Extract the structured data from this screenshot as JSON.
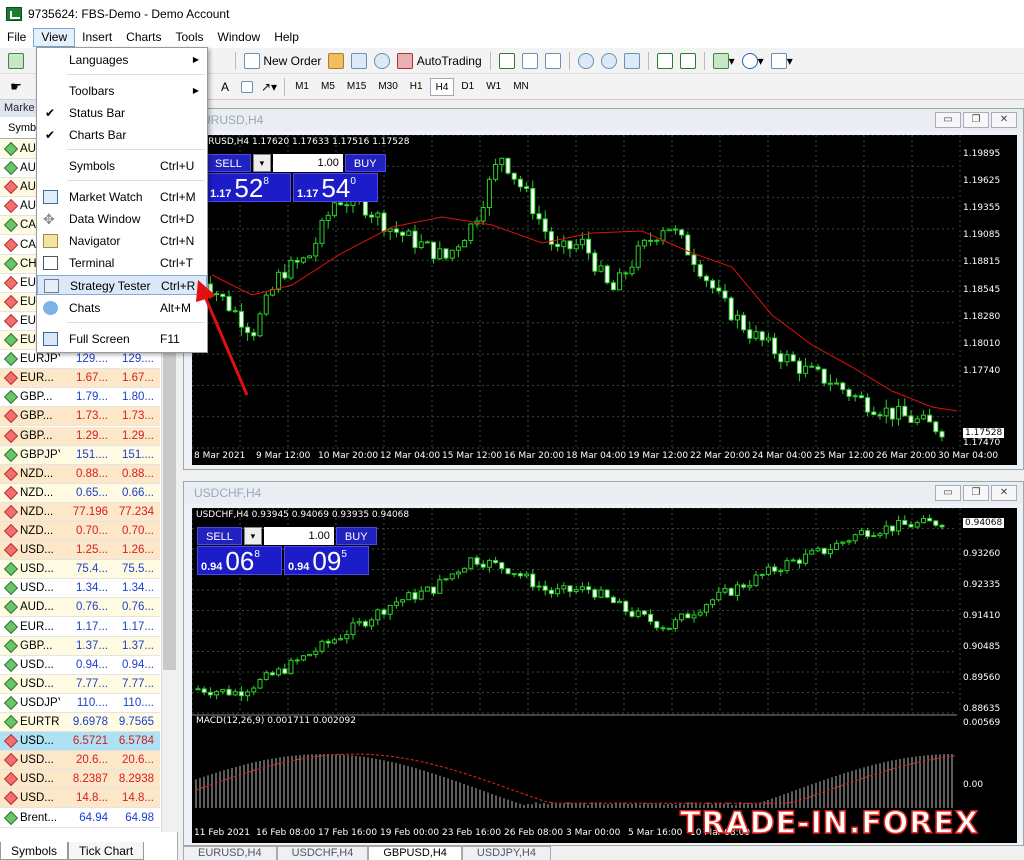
{
  "window": {
    "title": "9735624: FBS-Demo - Demo Account"
  },
  "menu": [
    "File",
    "View",
    "Insert",
    "Charts",
    "Tools",
    "Window",
    "Help"
  ],
  "toolbar": {
    "new_order": "New Order",
    "autotrading": "AutoTrading",
    "timeframes": [
      "M1",
      "M5",
      "M15",
      "M30",
      "H1",
      "H4",
      "D1",
      "W1",
      "MN"
    ],
    "selected_tf": "H4"
  },
  "view_menu": [
    {
      "label": "Languages",
      "shortcut": "",
      "submenu": true
    },
    {
      "label": "Toolbars",
      "shortcut": "",
      "submenu": true
    },
    {
      "label": "Status Bar",
      "shortcut": "",
      "checked": true
    },
    {
      "label": "Charts Bar",
      "shortcut": "",
      "checked": true
    },
    {
      "label": "Symbols",
      "shortcut": "Ctrl+U"
    },
    {
      "label": "Market Watch",
      "shortcut": "Ctrl+M",
      "icon": "market-watch-icon"
    },
    {
      "label": "Data Window",
      "shortcut": "Ctrl+D",
      "icon": "data-window-icon"
    },
    {
      "label": "Navigator",
      "shortcut": "Ctrl+N",
      "icon": "navigator-icon"
    },
    {
      "label": "Terminal",
      "shortcut": "Ctrl+T",
      "icon": "terminal-icon"
    },
    {
      "label": "Strategy Tester",
      "shortcut": "Ctrl+R",
      "icon": "strategy-tester-icon",
      "highlighted": true
    },
    {
      "label": "Chats",
      "shortcut": "Alt+M",
      "icon": "chats-icon"
    },
    {
      "label": "Full Screen",
      "shortcut": "F11",
      "icon": "full-screen-icon"
    }
  ],
  "market_watch": {
    "title": "Marke",
    "tab": "Symb",
    "rows": [
      {
        "sym": "AU",
        "bid": "",
        "ask": "",
        "up": true
      },
      {
        "sym": "AU",
        "bid": "",
        "ask": "",
        "up": true
      },
      {
        "sym": "AU",
        "bid": "",
        "ask": "",
        "up": false
      },
      {
        "sym": "AU",
        "bid": "",
        "ask": "",
        "up": false
      },
      {
        "sym": "CA",
        "bid": "",
        "ask": "",
        "up": true
      },
      {
        "sym": "CA",
        "bid": "",
        "ask": "",
        "up": false
      },
      {
        "sym": "CH",
        "bid": "",
        "ask": "",
        "up": true
      },
      {
        "sym": "EU",
        "bid": "",
        "ask": "",
        "up": false
      },
      {
        "sym": "EU",
        "bid": "",
        "ask": "",
        "up": false
      },
      {
        "sym": "EU",
        "bid": "",
        "ask": "",
        "up": false
      },
      {
        "sym": "EU",
        "bid": "",
        "ask": "",
        "up": true
      },
      {
        "sym": "EURJPY",
        "bid": "129....",
        "ask": "129....",
        "up": true
      },
      {
        "sym": "EUR...",
        "bid": "1.67...",
        "ask": "1.67...",
        "up": false,
        "red": true
      },
      {
        "sym": "GBP...",
        "bid": "1.79...",
        "ask": "1.80...",
        "up": true
      },
      {
        "sym": "GBP...",
        "bid": "1.73...",
        "ask": "1.73...",
        "up": false,
        "red": true
      },
      {
        "sym": "GBP...",
        "bid": "1.29...",
        "ask": "1.29...",
        "up": false,
        "red": true
      },
      {
        "sym": "GBPJPY",
        "bid": "151....",
        "ask": "151....",
        "up": true
      },
      {
        "sym": "NZD...",
        "bid": "0.88...",
        "ask": "0.88...",
        "up": false,
        "red": true
      },
      {
        "sym": "NZD...",
        "bid": "0.65...",
        "ask": "0.66...",
        "up": false
      },
      {
        "sym": "NZD...",
        "bid": "77.196",
        "ask": "77.234",
        "up": false,
        "red": true
      },
      {
        "sym": "NZD...",
        "bid": "0.70...",
        "ask": "0.70...",
        "up": false,
        "red": true
      },
      {
        "sym": "USD...",
        "bid": "1.25...",
        "ask": "1.26...",
        "up": false,
        "red": true
      },
      {
        "sym": "USD...",
        "bid": "75.4...",
        "ask": "75.5...",
        "up": true
      },
      {
        "sym": "USD...",
        "bid": "1.34...",
        "ask": "1.34...",
        "up": true
      },
      {
        "sym": "AUD...",
        "bid": "0.76...",
        "ask": "0.76...",
        "up": true
      },
      {
        "sym": "EUR...",
        "bid": "1.17...",
        "ask": "1.17...",
        "up": true
      },
      {
        "sym": "GBP...",
        "bid": "1.37...",
        "ask": "1.37...",
        "up": true
      },
      {
        "sym": "USD...",
        "bid": "0.94...",
        "ask": "0.94...",
        "up": true
      },
      {
        "sym": "USD...",
        "bid": "7.77...",
        "ask": "7.77...",
        "up": true
      },
      {
        "sym": "USDJPY",
        "bid": "110....",
        "ask": "110....",
        "up": true
      },
      {
        "sym": "EURTRY",
        "bid": "9.6978",
        "ask": "9.7565",
        "up": true
      },
      {
        "sym": "USD...",
        "bid": "6.5721",
        "ask": "6.5784",
        "up": false,
        "red": true
      },
      {
        "sym": "USD...",
        "bid": "20.6...",
        "ask": "20.6...",
        "up": false,
        "red": true
      },
      {
        "sym": "USD...",
        "bid": "8.2387",
        "ask": "8.2938",
        "up": false,
        "red": true
      },
      {
        "sym": "USD...",
        "bid": "14.8...",
        "ask": "14.8...",
        "up": false,
        "red": true
      },
      {
        "sym": "Brent...",
        "bid": "64.94",
        "ask": "64.98",
        "up": true
      }
    ],
    "bottom_tabs": [
      "Symbols",
      "Tick Chart"
    ]
  },
  "chart1": {
    "title": "EURUSD,H4",
    "ohlc": "EURUSD,H4  1.17620 1.17633 1.17516 1.17528",
    "sell": "SELL",
    "buy": "BUY",
    "lot": "1.00",
    "sell_big": [
      "1.17",
      "52",
      "8"
    ],
    "buy_big": [
      "1.17",
      "54",
      "0"
    ],
    "yticks": [
      "1.19895",
      "1.19625",
      "1.19355",
      "1.19085",
      "1.18815",
      "1.18545",
      "1.18280",
      "1.18010",
      "1.17740",
      "1.17528",
      "1.17470"
    ],
    "xticks": [
      "8 Mar 2021",
      "9 Mar 12:00",
      "10 Mar 20:00",
      "12 Mar 04:00",
      "15 Mar 12:00",
      "16 Mar 20:00",
      "18 Mar 04:00",
      "19 Mar 12:00",
      "22 Mar 20:00",
      "24 Mar 04:00",
      "25 Mar 12:00",
      "26 Mar 20:00",
      "30 Mar 04:00"
    ]
  },
  "chart2": {
    "title": "USDCHF,H4",
    "ohlc": "USDCHF,H4  0.93945 0.94069 0.93935 0.94068",
    "sell": "SELL",
    "buy": "BUY",
    "lot": "1.00",
    "sell_big": [
      "0.94",
      "06",
      "8"
    ],
    "buy_big": [
      "0.94",
      "09",
      "5"
    ],
    "yticks": [
      "0.94068",
      "0.93260",
      "0.92335",
      "0.91410",
      "0.90485",
      "0.89560",
      "0.88635"
    ],
    "macd_label": "MACD(12,26,9) 0.001711 0.002092",
    "macd_yticks": [
      "0.00569",
      "0.00"
    ],
    "xticks": [
      "11 Feb 2021",
      "16 Feb 08:00",
      "17 Feb 16:00",
      "19 Feb 00:00",
      "23 Feb 16:00",
      "26 Feb 08:00",
      "3 Mar 00:00",
      "5 Mar 16:00",
      "10 Mar 08:00"
    ]
  },
  "chart_tabs": [
    "EURUSD,H4",
    "USDCHF,H4",
    "GBPUSD,H4",
    "USDJPY,H4"
  ],
  "watermark": "TRADE-IN.FOREX"
}
